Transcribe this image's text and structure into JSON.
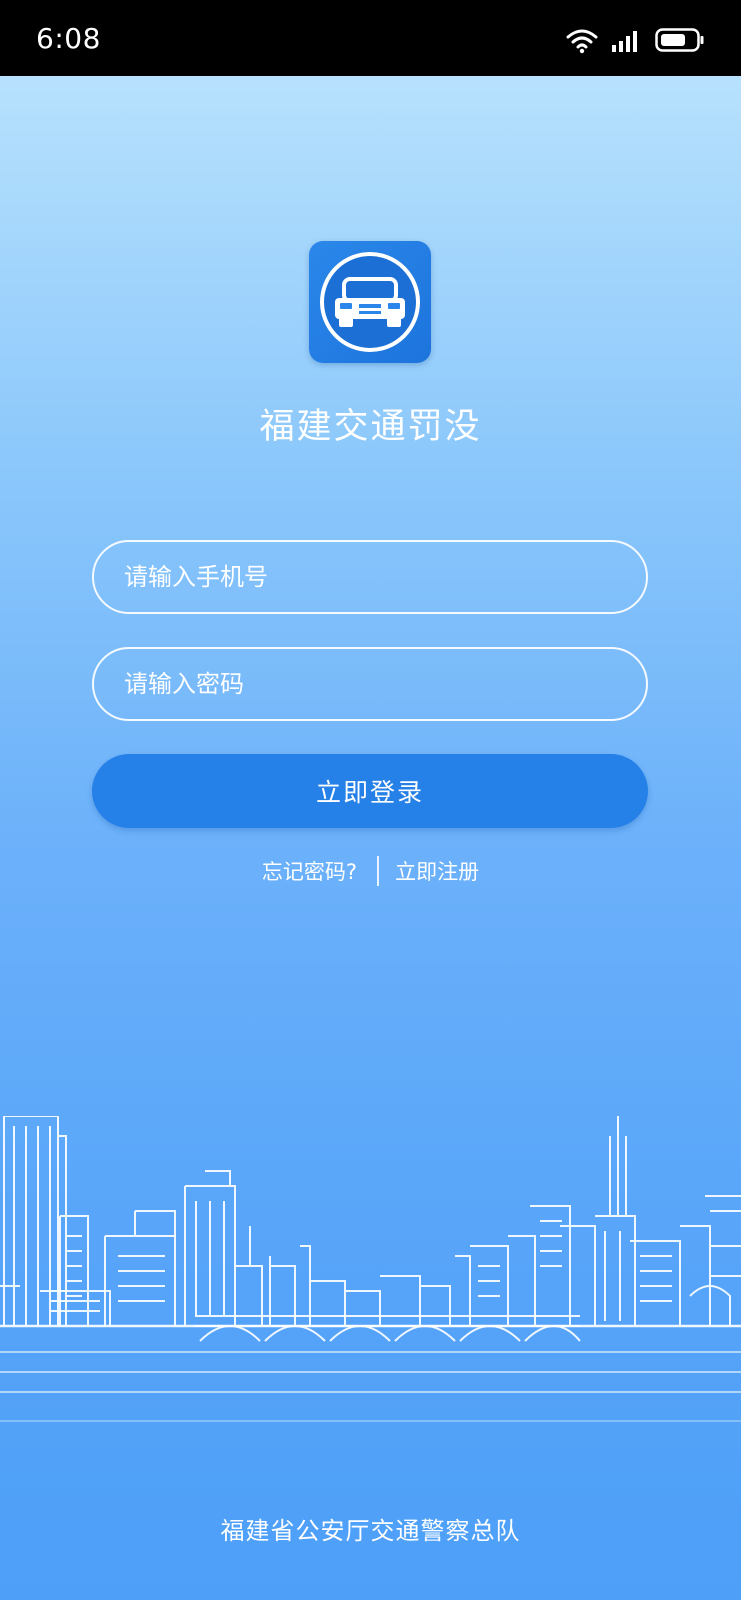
{
  "status_bar": {
    "time": "6:08",
    "wifi_icon": "wifi-icon",
    "signal_icon": "signal-bars-icon",
    "battery_icon": "battery-icon"
  },
  "app": {
    "logo_icon": "car-icon",
    "title": "福建交通罚没"
  },
  "form": {
    "phone_placeholder": "请输入手机号",
    "phone_value": "",
    "password_placeholder": "请输入密码",
    "password_value": "",
    "login_label": "立即登录"
  },
  "links": {
    "forgot_password": "忘记密码?",
    "register": "立即注册"
  },
  "footer": {
    "organization": "福建省公安厅交通警察总队"
  },
  "colors": {
    "gradient_top": "#b7e1fd",
    "gradient_bottom": "#4d9ff8",
    "login_button": "#2581e8",
    "logo_bg": "#2380e6"
  }
}
